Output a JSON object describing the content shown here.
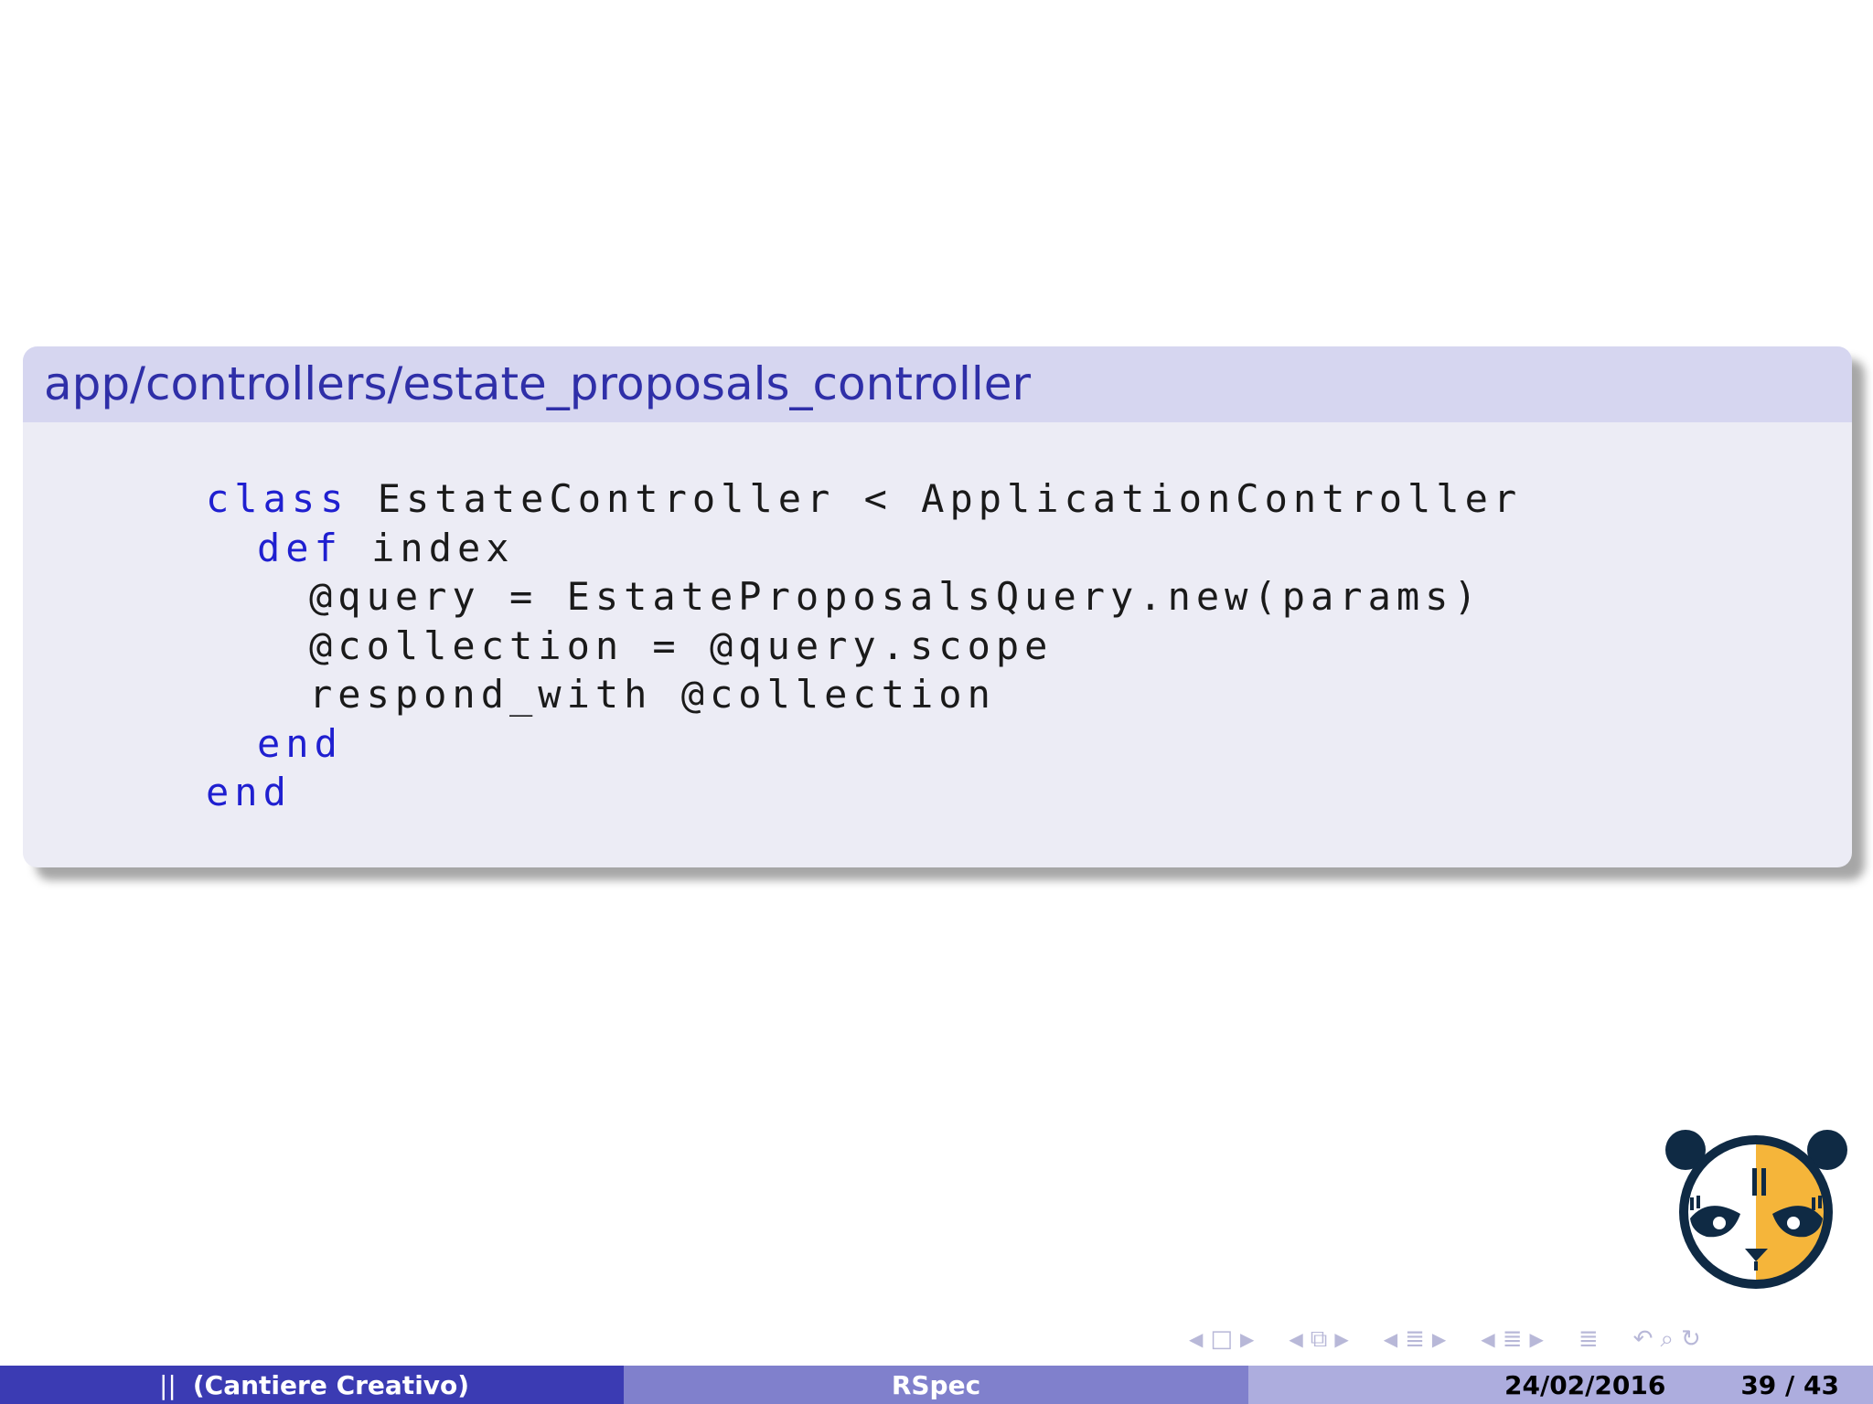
{
  "block": {
    "title": "app/controllers/estate_proposals_controller"
  },
  "code": {
    "line1_kw": "class",
    "line1_rest": " EstateController < ApplicationController",
    "line2_kw": "def",
    "line2_rest": " index",
    "line3": "@query = EstateProposalsQuery.new(params)",
    "line4": "@collection = @query.scope",
    "line5": "respond_with @collection",
    "line6_kw": "end",
    "line7_kw": "end"
  },
  "footer": {
    "separator": "||",
    "author": "(Cantiere Creativo)",
    "title": "RSpec",
    "date": "24/02/2016",
    "page": "39 / 43"
  },
  "colors": {
    "keyword": "#1f1fd0",
    "title_text": "#2f2fa8",
    "footer_left": "#3b3bb3",
    "footer_mid": "#8080cc",
    "footer_right": "#adadde",
    "logo_dark": "#0f2a44",
    "logo_yellow": "#f5b53a"
  },
  "icons": [
    "nav-prev-frame-icon",
    "nav-frame-icon",
    "nav-next-frame-icon",
    "nav-subsection-icon",
    "nav-section-icon",
    "nav-toc-icon",
    "search-icon",
    "undo-icon",
    "panda-logo"
  ]
}
